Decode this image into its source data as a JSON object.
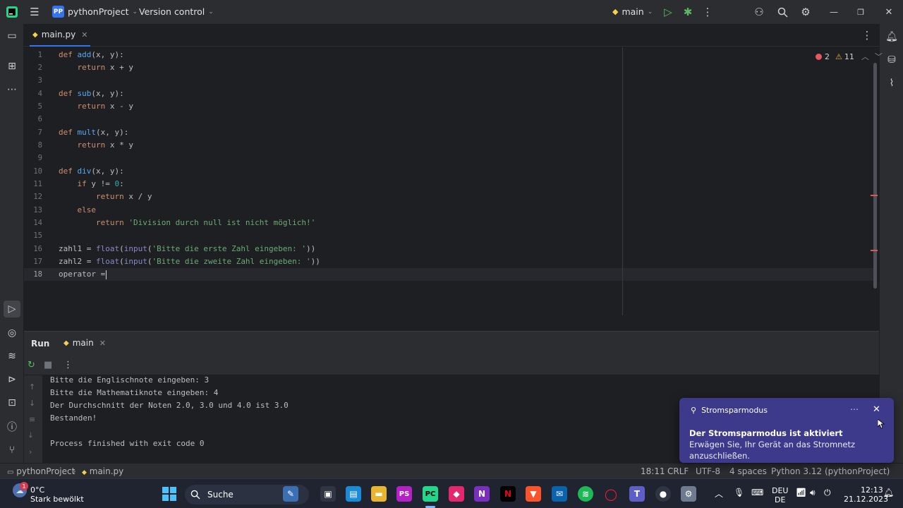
{
  "titlebar": {
    "project_badge": "PP",
    "project_name": "pythonProject",
    "vcs": "Version control",
    "run_config": "main"
  },
  "tabs": [
    {
      "label": "main.py"
    }
  ],
  "editor": {
    "inspections": {
      "errors": "2",
      "warnings": "11"
    },
    "line_numbers": [
      "1",
      "2",
      "3",
      "4",
      "5",
      "6",
      "7",
      "8",
      "9",
      "10",
      "11",
      "12",
      "13",
      "14",
      "15",
      "16",
      "17",
      "18"
    ],
    "lines": [
      "def add(x, y):",
      "    return x + y",
      "",
      "def sub(x, y):",
      "    return x - y",
      "",
      "def mult(x, y):",
      "    return x * y",
      "",
      "def div(x, y):",
      "    if y != 0:",
      "        return x / y",
      "    else",
      "        return 'Division durch null ist nicht möglich!'",
      "",
      "zahl1 = float(input('Bitte die erste Zahl eingeben: '))",
      "zahl2 = float(input('Bitte die zweite Zahl eingeben: '))",
      "operator ="
    ],
    "current_line": 18
  },
  "run": {
    "title": "Run",
    "tab": "main",
    "output": [
      "Bitte die Englischnote eingeben: 3",
      "Bitte die Mathematiknote eingeben: 4",
      "Der Durchschnitt der Noten 2.0, 3.0 und 4.0 ist 3.0",
      "Bestanden!",
      "",
      "Process finished with exit code 0"
    ]
  },
  "statusbar": {
    "breadcrumb_project": "pythonProject",
    "breadcrumb_file": "main.py",
    "position": "18:11",
    "line_sep": "CRLF",
    "encoding": "UTF-8",
    "indent": "4 spaces",
    "interpreter": "Python 3.12 (pythonProject)"
  },
  "toast": {
    "app": "Stromsparmodus",
    "title": "Der Stromsparmodus ist aktiviert",
    "body": "Erwägen Sie, Ihr Gerät an das Stromnetz anzuschließen."
  },
  "taskbar": {
    "weather_badge": "1",
    "temperature": "0°C",
    "weather": "Stark bewölkt",
    "search": "Suche",
    "lang_top": "DEU",
    "lang_bottom": "DE",
    "time": "12:13",
    "date": "21.12.2023"
  },
  "colors": {
    "accent": "#3574f0",
    "editor_bg": "#1e1f22",
    "panel_bg": "#2b2d30",
    "toast_bg": "#3d3a8c",
    "error": "#e55765"
  }
}
